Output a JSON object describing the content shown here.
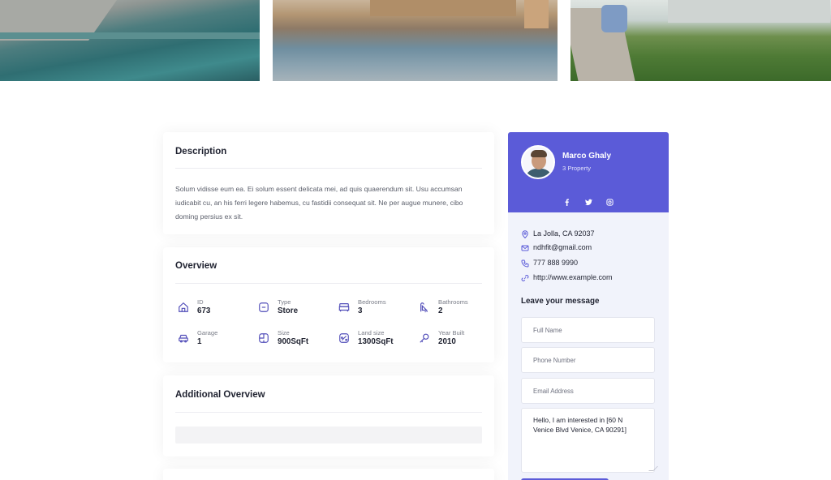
{
  "colors": {
    "accent": "#5b5bd8",
    "panel_bg": "#f1f3fb",
    "text": "#1f2230"
  },
  "gallery": [
    {
      "name": "pool-photo"
    },
    {
      "name": "waterfront-photo"
    },
    {
      "name": "garden-house-photo"
    }
  ],
  "description": {
    "title": "Description",
    "text": "Solum vidisse eum ea. Ei solum essent delicata mei, ad quis quaerendum sit. Usu accumsan iudicabit cu, an his ferri legere habemus, cu fastidii consequat sit. Ne per augue munere, cibo doming persius ex sit."
  },
  "overview": {
    "title": "Overview",
    "items": [
      {
        "label": "ID",
        "value": "673",
        "icon": "house-icon"
      },
      {
        "label": "Type",
        "value": "Store",
        "icon": "store-icon"
      },
      {
        "label": "Bedrooms",
        "value": "3",
        "icon": "bed-icon"
      },
      {
        "label": "Bathrooms",
        "value": "2",
        "icon": "shower-icon"
      },
      {
        "label": "Garage",
        "value": "1",
        "icon": "car-icon"
      },
      {
        "label": "Size",
        "value": "900SqFt",
        "icon": "floorplan-icon"
      },
      {
        "label": "Land size",
        "value": "1300SqFt",
        "icon": "land-icon"
      },
      {
        "label": "Year Built",
        "value": "2010",
        "icon": "key-icon"
      }
    ]
  },
  "additional": {
    "title": "Additional Overview"
  },
  "agent": {
    "name": "Marco Ghaly",
    "count": "3 Property",
    "socials": [
      "facebook-icon",
      "twitter-icon",
      "instagram-icon"
    ],
    "location": "La Jolla, CA 92037",
    "email": "ndhfit@gmail.com",
    "phone": "777 888 9990",
    "website": "http://www.example.com"
  },
  "form": {
    "title": "Leave your message",
    "full_name_placeholder": "Full Name",
    "phone_placeholder": "Phone Number",
    "email_placeholder": "Email Address",
    "message_value": "Hello, I am interested in [60 N Venice Blvd Venice, CA 90291]"
  }
}
